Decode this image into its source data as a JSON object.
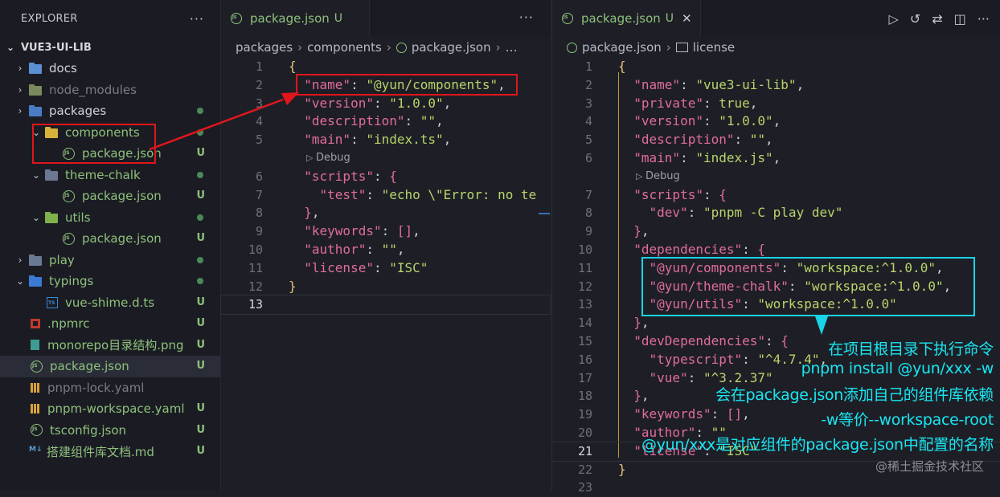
{
  "explorer": {
    "title": "EXPLORER",
    "menu": "···",
    "root": "VUE3-UI-LIB",
    "items": [
      {
        "label": "docs",
        "chev": "›",
        "icon": "folder-docs",
        "status": "none",
        "style": "normal"
      },
      {
        "label": "node_modules",
        "chev": "›",
        "icon": "folder-nm",
        "status": "none",
        "style": "dim"
      },
      {
        "label": "packages",
        "chev": "›",
        "icon": "folder-pkg",
        "status": "dot",
        "style": "normal"
      },
      {
        "label": "components",
        "chev": "⌄",
        "icon": "folder-comp",
        "status": "dot",
        "style": "green"
      },
      {
        "label": "package.json",
        "icon": "js",
        "status": "U",
        "style": "green"
      },
      {
        "label": "theme-chalk",
        "chev": "⌄",
        "icon": "folder-theme",
        "status": "dot",
        "style": "green"
      },
      {
        "label": "package.json",
        "icon": "js",
        "status": "U",
        "style": "green"
      },
      {
        "label": "utils",
        "chev": "⌄",
        "icon": "folder-utils",
        "status": "dot",
        "style": "green"
      },
      {
        "label": "package.json",
        "icon": "js",
        "status": "U",
        "style": "green"
      },
      {
        "label": "play",
        "chev": "›",
        "icon": "folder-play",
        "status": "dot",
        "style": "green"
      },
      {
        "label": "typings",
        "chev": "⌄",
        "icon": "folder-typ",
        "status": "dot",
        "style": "green"
      },
      {
        "label": "vue-shime.d.ts",
        "icon": "ts",
        "status": "U",
        "style": "green"
      },
      {
        "label": ".npmrc",
        "icon": "npm",
        "status": "U",
        "style": "green"
      },
      {
        "label": "monorepo目录结构.png",
        "icon": "img",
        "status": "U",
        "style": "green"
      },
      {
        "label": "package.json",
        "icon": "js",
        "status": "U",
        "style": "green"
      },
      {
        "label": "pnpm-lock.yaml",
        "icon": "yaml",
        "status": "none",
        "style": "dim"
      },
      {
        "label": "pnpm-workspace.yaml",
        "icon": "yaml",
        "status": "U",
        "style": "green"
      },
      {
        "label": "tsconfig.json",
        "icon": "js",
        "status": "U",
        "style": "green"
      },
      {
        "label": "搭建组件库文档.md",
        "icon": "md",
        "status": "U",
        "style": "green"
      }
    ]
  },
  "left_editor": {
    "tab": {
      "label": "package.json",
      "status": "U"
    },
    "menu": "···",
    "breadcrumb": [
      "packages",
      "components",
      "package.json",
      "…"
    ],
    "codelens": "Debug",
    "lines": [
      {
        "n": "1",
        "parts": [
          [
            "b",
            "{"
          ]
        ]
      },
      {
        "n": "2",
        "parts": [
          [
            "p",
            "  "
          ],
          [
            "k",
            "\"name\""
          ],
          [
            "p",
            ": "
          ],
          [
            "s",
            "\"@yun/components\""
          ],
          [
            "p",
            ","
          ]
        ]
      },
      {
        "n": "3",
        "parts": [
          [
            "p",
            "  "
          ],
          [
            "k",
            "\"version\""
          ],
          [
            "p",
            ": "
          ],
          [
            "s",
            "\"1.0.0\""
          ],
          [
            "p",
            ","
          ]
        ]
      },
      {
        "n": "4",
        "parts": [
          [
            "p",
            "  "
          ],
          [
            "k",
            "\"description\""
          ],
          [
            "p",
            ": "
          ],
          [
            "s",
            "\"\""
          ],
          [
            "p",
            ","
          ]
        ]
      },
      {
        "n": "5",
        "parts": [
          [
            "p",
            "  "
          ],
          [
            "k",
            "\"main\""
          ],
          [
            "p",
            ": "
          ],
          [
            "s",
            "\"index.ts\""
          ],
          [
            "p",
            ","
          ]
        ]
      },
      {
        "n": "6",
        "parts": [
          [
            "p",
            "  "
          ],
          [
            "k",
            "\"scripts\""
          ],
          [
            "p",
            ": "
          ],
          [
            "kw",
            "{"
          ]
        ]
      },
      {
        "n": "7",
        "parts": [
          [
            "p",
            "    "
          ],
          [
            "k",
            "\"test\""
          ],
          [
            "p",
            ": "
          ],
          [
            "s",
            "\"echo \\\"Error: no te"
          ]
        ]
      },
      {
        "n": "8",
        "parts": [
          [
            "p",
            "  "
          ],
          [
            "kw",
            "}"
          ],
          [
            "p",
            ","
          ]
        ]
      },
      {
        "n": "9",
        "parts": [
          [
            "p",
            "  "
          ],
          [
            "k",
            "\"keywords\""
          ],
          [
            "p",
            ": "
          ],
          [
            "kw",
            "[]"
          ],
          [
            "p",
            ","
          ]
        ]
      },
      {
        "n": "10",
        "parts": [
          [
            "p",
            "  "
          ],
          [
            "k",
            "\"author\""
          ],
          [
            "p",
            ": "
          ],
          [
            "s",
            "\"\""
          ],
          [
            "p",
            ","
          ]
        ]
      },
      {
        "n": "11",
        "parts": [
          [
            "p",
            "  "
          ],
          [
            "k",
            "\"license\""
          ],
          [
            "p",
            ": "
          ],
          [
            "s",
            "\"ISC\""
          ]
        ]
      },
      {
        "n": "12",
        "parts": [
          [
            "b",
            "}"
          ]
        ]
      },
      {
        "n": "13",
        "parts": []
      }
    ]
  },
  "right_editor": {
    "tab": {
      "label": "package.json",
      "status": "U",
      "close": "✕"
    },
    "toolbar_icons": [
      "run-icon",
      "history-icon",
      "compare-icon",
      "split-editor-icon",
      "more-icon"
    ],
    "breadcrumb": [
      "package.json",
      "license"
    ],
    "codelens": "Debug",
    "lines": [
      {
        "n": "1",
        "parts": [
          [
            "b",
            "{"
          ]
        ]
      },
      {
        "n": "2",
        "parts": [
          [
            "p",
            "  "
          ],
          [
            "k",
            "\"name\""
          ],
          [
            "p",
            ": "
          ],
          [
            "s",
            "\"vue3-ui-lib\""
          ],
          [
            "p",
            ","
          ]
        ]
      },
      {
        "n": "3",
        "parts": [
          [
            "p",
            "  "
          ],
          [
            "k",
            "\"private\""
          ],
          [
            "p",
            ": "
          ],
          [
            "s",
            "true"
          ],
          [
            "p",
            ","
          ]
        ]
      },
      {
        "n": "4",
        "parts": [
          [
            "p",
            "  "
          ],
          [
            "k",
            "\"version\""
          ],
          [
            "p",
            ": "
          ],
          [
            "s",
            "\"1.0.0\""
          ],
          [
            "p",
            ","
          ]
        ]
      },
      {
        "n": "5",
        "parts": [
          [
            "p",
            "  "
          ],
          [
            "k",
            "\"description\""
          ],
          [
            "p",
            ": "
          ],
          [
            "s",
            "\"\""
          ],
          [
            "p",
            ","
          ]
        ]
      },
      {
        "n": "6",
        "parts": [
          [
            "p",
            "  "
          ],
          [
            "k",
            "\"main\""
          ],
          [
            "p",
            ": "
          ],
          [
            "s",
            "\"index.js\""
          ],
          [
            "p",
            ","
          ]
        ]
      },
      {
        "n": "7",
        "parts": [
          [
            "p",
            "  "
          ],
          [
            "k",
            "\"scripts\""
          ],
          [
            "p",
            ": "
          ],
          [
            "kw",
            "{"
          ]
        ]
      },
      {
        "n": "8",
        "parts": [
          [
            "p",
            "    "
          ],
          [
            "k",
            "\"dev\""
          ],
          [
            "p",
            ": "
          ],
          [
            "s",
            "\"pnpm -C play dev\""
          ]
        ]
      },
      {
        "n": "9",
        "parts": [
          [
            "p",
            "  "
          ],
          [
            "kw",
            "}"
          ],
          [
            "p",
            ","
          ]
        ]
      },
      {
        "n": "10",
        "parts": [
          [
            "p",
            "  "
          ],
          [
            "k",
            "\"dependencies\""
          ],
          [
            "p",
            ": "
          ],
          [
            "kw",
            "{"
          ]
        ]
      },
      {
        "n": "11",
        "parts": [
          [
            "p",
            "    "
          ],
          [
            "k",
            "\"@yun/components\""
          ],
          [
            "p",
            ": "
          ],
          [
            "s",
            "\"workspace:^1.0.0\""
          ],
          [
            "p",
            ","
          ]
        ]
      },
      {
        "n": "12",
        "parts": [
          [
            "p",
            "    "
          ],
          [
            "k",
            "\"@yun/theme-chalk\""
          ],
          [
            "p",
            ": "
          ],
          [
            "s",
            "\"workspace:^1.0.0\""
          ],
          [
            "p",
            ","
          ]
        ]
      },
      {
        "n": "13",
        "parts": [
          [
            "p",
            "    "
          ],
          [
            "k",
            "\"@yun/utils\""
          ],
          [
            "p",
            ": "
          ],
          [
            "s",
            "\"workspace:^1.0.0\""
          ]
        ]
      },
      {
        "n": "14",
        "parts": [
          [
            "p",
            "  "
          ],
          [
            "kw",
            "}"
          ],
          [
            "p",
            ","
          ]
        ]
      },
      {
        "n": "15",
        "parts": [
          [
            "p",
            "  "
          ],
          [
            "k",
            "\"devDependencies\""
          ],
          [
            "p",
            ": "
          ],
          [
            "kw",
            "{"
          ]
        ]
      },
      {
        "n": "16",
        "parts": [
          [
            "p",
            "    "
          ],
          [
            "k",
            "\"typescript\""
          ],
          [
            "p",
            ": "
          ],
          [
            "s",
            "\"^4.7.4\""
          ],
          [
            "p",
            ","
          ]
        ]
      },
      {
        "n": "17",
        "parts": [
          [
            "p",
            "    "
          ],
          [
            "k",
            "\"vue\""
          ],
          [
            "p",
            ": "
          ],
          [
            "s",
            "\"^3.2.37\""
          ]
        ]
      },
      {
        "n": "18",
        "parts": [
          [
            "p",
            "  "
          ],
          [
            "kw",
            "}"
          ],
          [
            "p",
            ","
          ]
        ]
      },
      {
        "n": "19",
        "parts": [
          [
            "p",
            "  "
          ],
          [
            "k",
            "\"keywords\""
          ],
          [
            "p",
            ": "
          ],
          [
            "kw",
            "[]"
          ],
          [
            "p",
            ","
          ]
        ]
      },
      {
        "n": "20",
        "parts": [
          [
            "p",
            "  "
          ],
          [
            "k",
            "\"author\""
          ],
          [
            "p",
            ": "
          ],
          [
            "s",
            "\"\""
          ]
        ]
      },
      {
        "n": "21",
        "parts": [
          [
            "p",
            "  "
          ],
          [
            "k",
            "\"license\""
          ],
          [
            "p",
            ": "
          ],
          [
            "s",
            "\"ISC\""
          ]
        ]
      },
      {
        "n": "22",
        "parts": [
          [
            "b",
            "}"
          ]
        ]
      },
      {
        "n": "23",
        "parts": []
      }
    ]
  },
  "annotation": {
    "lines": [
      "在项目根目录下执行命令",
      "pnpm install @yun/xxx -w",
      "会在package.json添加自己的组件库依赖",
      "-w等价--workspace-root",
      "@yun/xxx是对应组件的package.json中配置的名称"
    ]
  },
  "watermark": "@稀土掘金技术社区",
  "colors": {
    "annotation_red": "#e0161b",
    "annotation_cyan": "#19d3e6",
    "untracked_green": "#8ec07c"
  }
}
